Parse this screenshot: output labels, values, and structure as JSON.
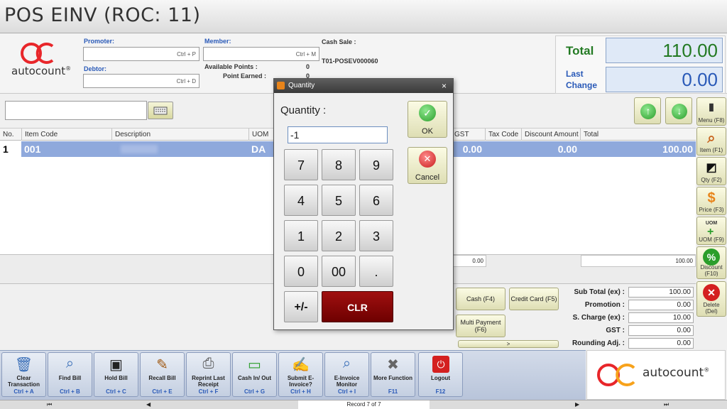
{
  "window": {
    "title": "POS EINV (ROC: 11)"
  },
  "brand": {
    "name": "autocount",
    "reg": "®"
  },
  "header": {
    "promoter": {
      "label": "Promoter:",
      "hint": "Ctrl + P"
    },
    "member": {
      "label": "Member:",
      "hint": "Ctrl + M"
    },
    "debtor": {
      "label": "Debtor:",
      "hint": "Ctrl + D"
    },
    "available_points": {
      "label": "Available Points :",
      "value": "0"
    },
    "point_earned": {
      "label": "Point Earned :",
      "value": "0"
    },
    "cash_sale": {
      "label": "Cash Sale :",
      "doc_no": "T01-POSEV000060"
    }
  },
  "totals": {
    "total_label": "Total",
    "total_value": "110.00",
    "last_change_label_1": "Last",
    "last_change_label_2": "Change",
    "last_change_value": "0.00"
  },
  "side_buttons": [
    {
      "label": "Menu (F8)"
    },
    {
      "label": "Item (F1)"
    },
    {
      "label": "Qty (F2)"
    },
    {
      "label": "Price (F3)"
    },
    {
      "label": "UOM (F9)",
      "icon_text": "UOM"
    },
    {
      "label": "Discount (F10)"
    },
    {
      "label": "Delete (Del)"
    }
  ],
  "table": {
    "columns": [
      "No.",
      "Item Code",
      "Description",
      "UOM",
      "GST",
      "Tax Code",
      "Discount Amount",
      "Total"
    ],
    "rows": [
      {
        "no": "1",
        "item_code": "001",
        "uom": "DA",
        "gst": "0.00",
        "discount": "0.00",
        "total": "100.00"
      }
    ],
    "summary": {
      "gst": "0.00",
      "total": "100.00"
    }
  },
  "payment": {
    "cash": "Cash (F4)",
    "credit_card": "Credit Card (F5)",
    "multi_payment": "Multi Payment (F6)",
    "more_arrow": ">"
  },
  "summary": {
    "subtotal": {
      "label": "Sub Total (ex) :",
      "value": "100.00"
    },
    "promotion": {
      "label": "Promotion :",
      "value": "0.00"
    },
    "service_charge": {
      "label": "S. Charge (ex) :",
      "value": "10.00"
    },
    "gst": {
      "label": "GST :",
      "value": "0.00"
    },
    "rounding": {
      "label": "Rounding Adj. :",
      "value": "0.00"
    }
  },
  "function_buttons": [
    {
      "label": "Clear Transaction",
      "key": "Ctrl + A"
    },
    {
      "label": "Find Bill",
      "key": "Ctrl + B"
    },
    {
      "label": "Hold Bill",
      "key": "Ctrl + C"
    },
    {
      "label": "Recall Bill",
      "key": "Ctrl + E"
    },
    {
      "label": "Reprint Last Receipt",
      "key": "Ctrl + F"
    },
    {
      "label": "Cash In/ Out",
      "key": "Ctrl + G"
    },
    {
      "label": "Submit E-Invoice?",
      "key": "Ctrl + H"
    },
    {
      "label": "E-Invoice Monitor",
      "key": "Ctrl + I"
    },
    {
      "label": "More Function",
      "key": "F11"
    },
    {
      "label": "Logout",
      "key": "F12"
    }
  ],
  "navigator": {
    "record_text": "Record 7 of 7"
  },
  "dialog": {
    "title": "Quantity",
    "close": "×",
    "prompt": "Quantity :",
    "value": "-1",
    "ok": "OK",
    "cancel": "Cancel",
    "keys": [
      "7",
      "8",
      "9",
      "4",
      "5",
      "6",
      "1",
      "2",
      "3",
      "0",
      "00",
      "."
    ],
    "plus_minus": "+/-",
    "clear": "CLR"
  },
  "colors": {
    "total_green": "#237a23",
    "accent_blue": "#2a5ab8",
    "row_highlight": "#8fa9dc",
    "clr_red": "#8b0000"
  }
}
